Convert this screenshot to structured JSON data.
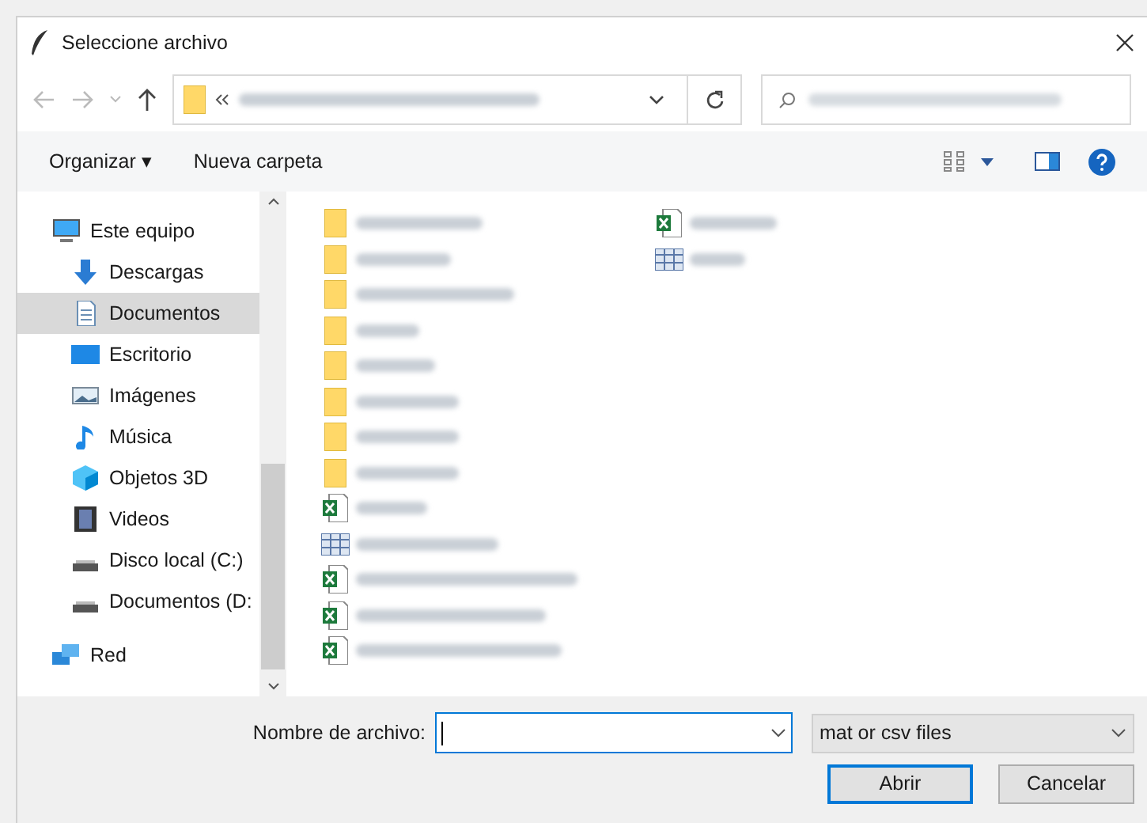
{
  "window": {
    "title": "Seleccione archivo"
  },
  "toolbar": {
    "organize": "Organizar ▾",
    "new_folder": "Nueva carpeta"
  },
  "sidebar": {
    "items": [
      {
        "label": "Este equipo",
        "kind": "pc",
        "selected": false,
        "children": [
          {
            "label": "Descargas",
            "kind": "download",
            "selected": false
          },
          {
            "label": "Documentos",
            "kind": "document",
            "selected": true
          },
          {
            "label": "Escritorio",
            "kind": "desktop",
            "selected": false
          },
          {
            "label": "Imágenes",
            "kind": "image",
            "selected": false
          },
          {
            "label": "Música",
            "kind": "music",
            "selected": false
          },
          {
            "label": "Objetos 3D",
            "kind": "cube",
            "selected": false
          },
          {
            "label": "Videos",
            "kind": "film",
            "selected": false
          },
          {
            "label": "Disco local (C:)",
            "kind": "drive",
            "selected": false
          },
          {
            "label": "Documentos (D:",
            "kind": "drive",
            "selected": false
          }
        ]
      },
      {
        "label": "Red",
        "kind": "network",
        "selected": false
      }
    ]
  },
  "files": [
    {
      "kind": "folder"
    },
    {
      "kind": "folder"
    },
    {
      "kind": "folder"
    },
    {
      "kind": "folder"
    },
    {
      "kind": "folder"
    },
    {
      "kind": "folder"
    },
    {
      "kind": "folder"
    },
    {
      "kind": "folder"
    },
    {
      "kind": "excel"
    },
    {
      "kind": "table"
    },
    {
      "kind": "excel"
    },
    {
      "kind": "excel"
    },
    {
      "kind": "excel"
    },
    {
      "kind": "excel"
    },
    {
      "kind": "table"
    }
  ],
  "footer": {
    "filename_label": "Nombre de archivo:",
    "file_type": "mat or csv files",
    "open": "Abrir",
    "cancel": "Cancelar"
  }
}
